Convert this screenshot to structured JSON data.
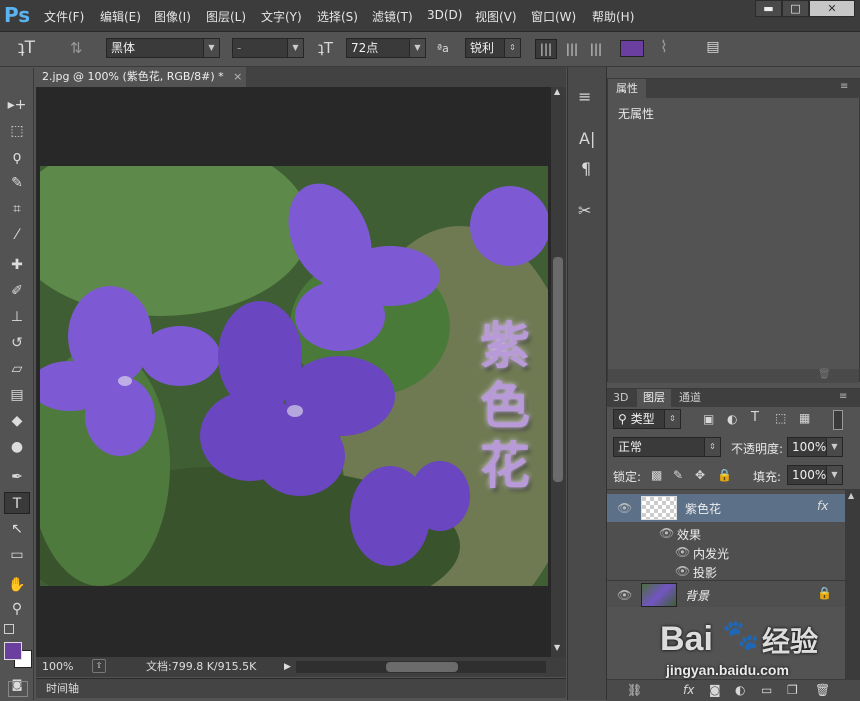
{
  "app": {
    "logo": "Ps"
  },
  "menu": [
    "文件(F)",
    "编辑(E)",
    "图像(I)",
    "图层(L)",
    "文字(Y)",
    "选择(S)",
    "滤镜(T)",
    "3D(D)",
    "视图(V)",
    "窗口(W)",
    "帮助(H)"
  ],
  "window_controls": {
    "minimize": "▬",
    "maximize": "□",
    "close": "✕"
  },
  "options": {
    "font_family": "黑体",
    "font_style": "-",
    "font_size": "72点",
    "aa_label": "ªa",
    "antialias": "锐利",
    "color": "#6b3fa0"
  },
  "document": {
    "tab_title": "2.jpg @ 100% (紫色花, RGB/8#) *",
    "overlay_text": [
      "紫",
      "色",
      "花"
    ],
    "zoom": "100%",
    "doc_info": "文档:799.8 K/915.5K"
  },
  "timeline": {
    "label": "时间轴"
  },
  "properties": {
    "title": "属性",
    "empty": "无属性"
  },
  "layers_panel": {
    "tabs": [
      "3D",
      "图层",
      "通道"
    ],
    "filter_type": "类型",
    "blend_mode": "正常",
    "opacity_label": "不透明度:",
    "opacity": "100%",
    "lock_label": "锁定:",
    "fill_label": "填充:",
    "fill": "100%",
    "layers": [
      {
        "name": "紫色花",
        "fx": "fx",
        "effects_label": "效果",
        "effects": [
          "内发光",
          "投影"
        ]
      },
      {
        "name": "背景"
      }
    ]
  },
  "colors": {
    "foreground": "#6b3fa0",
    "background": "#ffffff",
    "accent": "#5ab4f2"
  },
  "watermark": {
    "brand": "Bai",
    "suffix": "经验",
    "url": "jingyan.baidu.com"
  }
}
